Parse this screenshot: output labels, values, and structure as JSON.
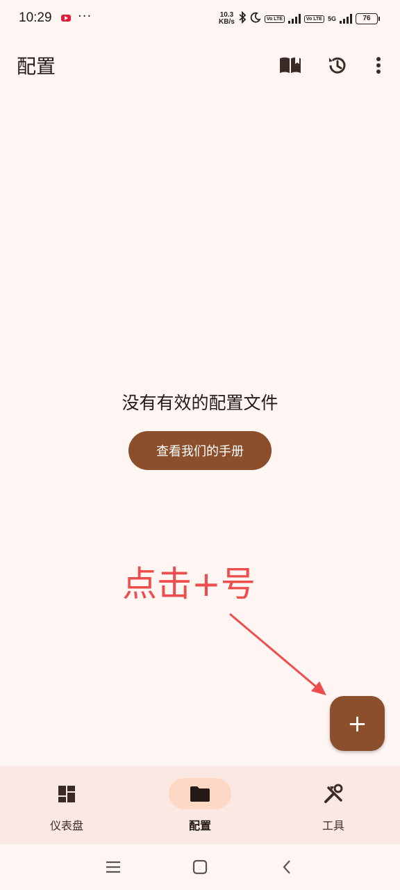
{
  "status_bar": {
    "time": "10:29",
    "overflow": "···",
    "net_speed_value": "10.3",
    "net_speed_unit": "KB/s",
    "volte1": "Vo LTE",
    "volte2": "Vo LTE",
    "network": "5G",
    "battery": "76",
    "icons": [
      "youtube-notification-icon",
      "bluetooth-icon",
      "moon-icon",
      "signal-icon",
      "battery-icon"
    ]
  },
  "app_bar": {
    "title": "配置",
    "actions": [
      "book-icon",
      "history-icon",
      "more-vert-icon"
    ]
  },
  "empty_state": {
    "message": "没有有效的配置文件",
    "button_label": "查看我们的手册"
  },
  "annotation": {
    "text": "点击+号",
    "color": "#ee4d4d"
  },
  "fab": {
    "icon": "plus-icon",
    "label": "+"
  },
  "bottom_nav": {
    "items": [
      {
        "label": "仪表盘",
        "icon": "dashboard-icon",
        "active": false
      },
      {
        "label": "配置",
        "icon": "folder-icon",
        "active": true
      },
      {
        "label": "工具",
        "icon": "tools-icon",
        "active": false
      }
    ]
  },
  "colors": {
    "background": "#fff5f3",
    "primary": "#8b4f2c",
    "nav_background": "#fbe8e2",
    "nav_active_pill": "#fdd9c5"
  }
}
